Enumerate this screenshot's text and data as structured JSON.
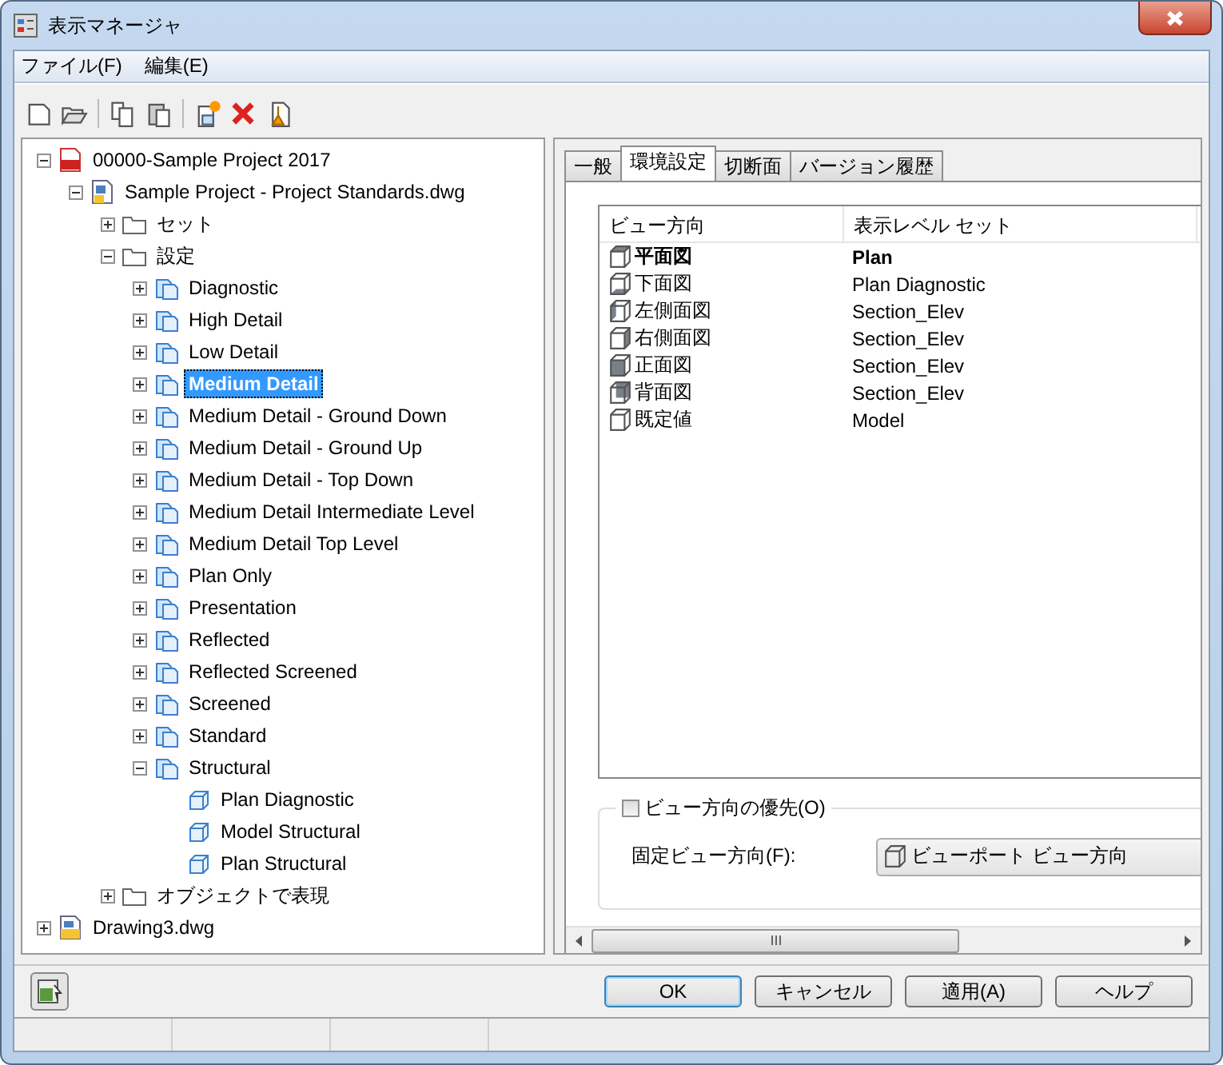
{
  "window": {
    "title": "表示マネージャ"
  },
  "menu": [
    "ファイル(F)",
    "編集(E)"
  ],
  "toolbar": [
    {
      "kind": "new"
    },
    {
      "kind": "open"
    },
    {
      "kind": "separator"
    },
    {
      "kind": "copy"
    },
    {
      "kind": "paste"
    },
    {
      "kind": "separator"
    },
    {
      "kind": "create"
    },
    {
      "kind": "delete"
    },
    {
      "kind": "purge"
    }
  ],
  "tree": [
    {
      "label": "00000-Sample Project 2017",
      "kind": "project",
      "selected": false,
      "expanded": true,
      "children": [
        {
          "label": "Sample Project - Project Standards.dwg",
          "kind": "drawing",
          "selected": false,
          "expanded": true,
          "children": [
            {
              "label": "セット",
              "kind": "folder",
              "selected": false,
              "expanded": false
            },
            {
              "label": "設定",
              "kind": "folder",
              "selected": false,
              "expanded": true,
              "children": [
                {
                  "label": "Diagnostic",
                  "kind": "config",
                  "selected": false,
                  "expanded": false
                },
                {
                  "label": "High Detail",
                  "kind": "config",
                  "selected": false,
                  "expanded": false
                },
                {
                  "label": "Low Detail",
                  "kind": "config",
                  "selected": false,
                  "expanded": false
                },
                {
                  "label": "Medium Detail",
                  "kind": "config",
                  "selected": true,
                  "expanded": false
                },
                {
                  "label": "Medium Detail - Ground Down",
                  "kind": "config",
                  "selected": false,
                  "expanded": false
                },
                {
                  "label": "Medium Detail - Ground Up",
                  "kind": "config",
                  "selected": false,
                  "expanded": false
                },
                {
                  "label": "Medium Detail - Top Down",
                  "kind": "config",
                  "selected": false,
                  "expanded": false
                },
                {
                  "label": "Medium Detail Intermediate Level",
                  "kind": "config",
                  "selected": false,
                  "expanded": false
                },
                {
                  "label": "Medium Detail Top Level",
                  "kind": "config",
                  "selected": false,
                  "expanded": false
                },
                {
                  "label": "Plan Only",
                  "kind": "config",
                  "selected": false,
                  "expanded": false
                },
                {
                  "label": "Presentation",
                  "kind": "config",
                  "selected": false,
                  "expanded": false
                },
                {
                  "label": "Reflected",
                  "kind": "config",
                  "selected": false,
                  "expanded": false
                },
                {
                  "label": "Reflected Screened",
                  "kind": "config",
                  "selected": false,
                  "expanded": false
                },
                {
                  "label": "Screened",
                  "kind": "config",
                  "selected": false,
                  "expanded": false
                },
                {
                  "label": "Standard",
                  "kind": "config",
                  "selected": false,
                  "expanded": false
                },
                {
                  "label": "Structural",
                  "kind": "config",
                  "selected": false,
                  "expanded": true,
                  "children": [
                    {
                      "label": "Plan Diagnostic",
                      "kind": "set",
                      "selected": false
                    },
                    {
                      "label": "Model Structural",
                      "kind": "set",
                      "selected": false
                    },
                    {
                      "label": "Plan Structural",
                      "kind": "set",
                      "selected": false
                    }
                  ]
                }
              ]
            },
            {
              "label": "オブジェクトで表現",
              "kind": "folder",
              "selected": false,
              "expanded": false
            }
          ]
        }
      ]
    },
    {
      "label": "Drawing3.dwg",
      "kind": "drawing2",
      "selected": false,
      "expanded": false
    }
  ],
  "tabs": [
    {
      "label": "一般",
      "selected": false
    },
    {
      "label": "環境設定",
      "selected": true
    },
    {
      "label": "切断面",
      "selected": false
    },
    {
      "label": "バージョン履歴",
      "selected": false
    }
  ],
  "table": {
    "columns": [
      "ビュー方向",
      "表示レベル セット"
    ],
    "rows": [
      {
        "view": "平面図",
        "set": "Plan",
        "kind": "top",
        "active": true
      },
      {
        "view": "下面図",
        "set": "Plan Diagnostic",
        "kind": "bottom",
        "active": false
      },
      {
        "view": "左側面図",
        "set": "Section_Elev",
        "kind": "left",
        "active": false
      },
      {
        "view": "右側面図",
        "set": "Section_Elev",
        "kind": "right",
        "active": false
      },
      {
        "view": "正面図",
        "set": "Section_Elev",
        "kind": "front",
        "active": false
      },
      {
        "view": "背面図",
        "set": "Section_Elev",
        "kind": "back",
        "active": false
      },
      {
        "view": "既定値",
        "set": "Model",
        "kind": "none",
        "active": false
      }
    ]
  },
  "override": {
    "label": "ビュー方向の優先(O)",
    "checked": false,
    "field_label": "固定ビュー方向(F):",
    "value": "ビューポート ビュー方向"
  },
  "buttons": [
    {
      "label": "OK",
      "default": true
    },
    {
      "label": "キャンセル",
      "default": false
    },
    {
      "label": "適用(A)",
      "default": false
    },
    {
      "label": "ヘルプ",
      "default": false
    }
  ]
}
